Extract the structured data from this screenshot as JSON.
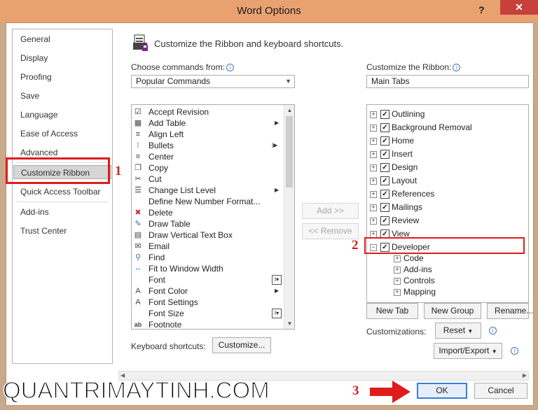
{
  "window": {
    "title": "Word Options",
    "help": "?",
    "close": "✕"
  },
  "nav": {
    "items": [
      {
        "label": "General"
      },
      {
        "label": "Display"
      },
      {
        "label": "Proofing"
      },
      {
        "label": "Save"
      },
      {
        "label": "Language"
      },
      {
        "label": "Ease of Access"
      },
      {
        "label": "Advanced"
      },
      {
        "label": "Customize Ribbon",
        "selected": true
      },
      {
        "label": "Quick Access Toolbar"
      },
      {
        "label": "Add-ins"
      },
      {
        "label": "Trust Center"
      }
    ]
  },
  "annotations": {
    "step1": "1",
    "step2": "2",
    "step3": "3",
    "color": "#e01b1b"
  },
  "header": {
    "text": "Customize the Ribbon and keyboard shortcuts."
  },
  "left_panel": {
    "label": "Choose commands from:",
    "selected": "Popular Commands",
    "commands": [
      {
        "label": "Accept Revision",
        "icon": "accept-revision-icon"
      },
      {
        "label": "Add Table",
        "icon": "table-icon",
        "submenu": true
      },
      {
        "label": "Align Left",
        "icon": "align-left-icon"
      },
      {
        "label": "Bullets",
        "icon": "bullets-icon",
        "split": true
      },
      {
        "label": "Center",
        "icon": "center-align-icon"
      },
      {
        "label": "Copy",
        "icon": "copy-icon"
      },
      {
        "label": "Cut",
        "icon": "cut-icon"
      },
      {
        "label": "Change List Level",
        "icon": "list-level-icon",
        "submenu": true
      },
      {
        "label": "Define New Number Format...",
        "icon": ""
      },
      {
        "label": "Delete",
        "icon": "delete-icon"
      },
      {
        "label": "Draw Table",
        "icon": "draw-table-icon"
      },
      {
        "label": "Draw Vertical Text Box",
        "icon": "text-box-icon"
      },
      {
        "label": "Email",
        "icon": "email-icon"
      },
      {
        "label": "Find",
        "icon": "find-icon"
      },
      {
        "label": "Fit to Window Width",
        "icon": "fit-width-icon"
      },
      {
        "label": "Font",
        "icon": "",
        "box": true
      },
      {
        "label": "Font Color",
        "icon": "font-color-icon",
        "submenu": true
      },
      {
        "label": "Font Settings",
        "icon": "font-settings-icon"
      },
      {
        "label": "Font Size",
        "icon": "",
        "box": true
      },
      {
        "label": "Footnote",
        "icon": "footnote-icon"
      }
    ]
  },
  "middle": {
    "add": "Add >>",
    "remove": "<< Remove"
  },
  "right_panel": {
    "label": "Customize the Ribbon:",
    "selected": "Main Tabs",
    "tabs": [
      {
        "label": "Outlining",
        "checked": true
      },
      {
        "label": "Background Removal",
        "checked": true
      },
      {
        "label": "Home",
        "checked": true
      },
      {
        "label": "Insert",
        "checked": true
      },
      {
        "label": "Design",
        "checked": true
      },
      {
        "label": "Layout",
        "checked": true
      },
      {
        "label": "References",
        "checked": true
      },
      {
        "label": "Mailings",
        "checked": true
      },
      {
        "label": "Review",
        "checked": true
      },
      {
        "label": "View",
        "checked": true
      },
      {
        "label": "Developer",
        "checked": true,
        "expanded": true
      }
    ],
    "developer_groups": [
      "Code",
      "Add-ins",
      "Controls",
      "Mapping"
    ],
    "new_tab": "New Tab",
    "new_group": "New Group",
    "rename": "Rename...",
    "customizations_label": "Customizations:",
    "reset": "Reset",
    "import_export": "Import/Export"
  },
  "keyboard": {
    "label": "Keyboard shortcuts:",
    "button": "Customize..."
  },
  "footer": {
    "ok": "OK",
    "cancel": "Cancel"
  },
  "watermark": "QUANTRIMAYTINH.COM"
}
